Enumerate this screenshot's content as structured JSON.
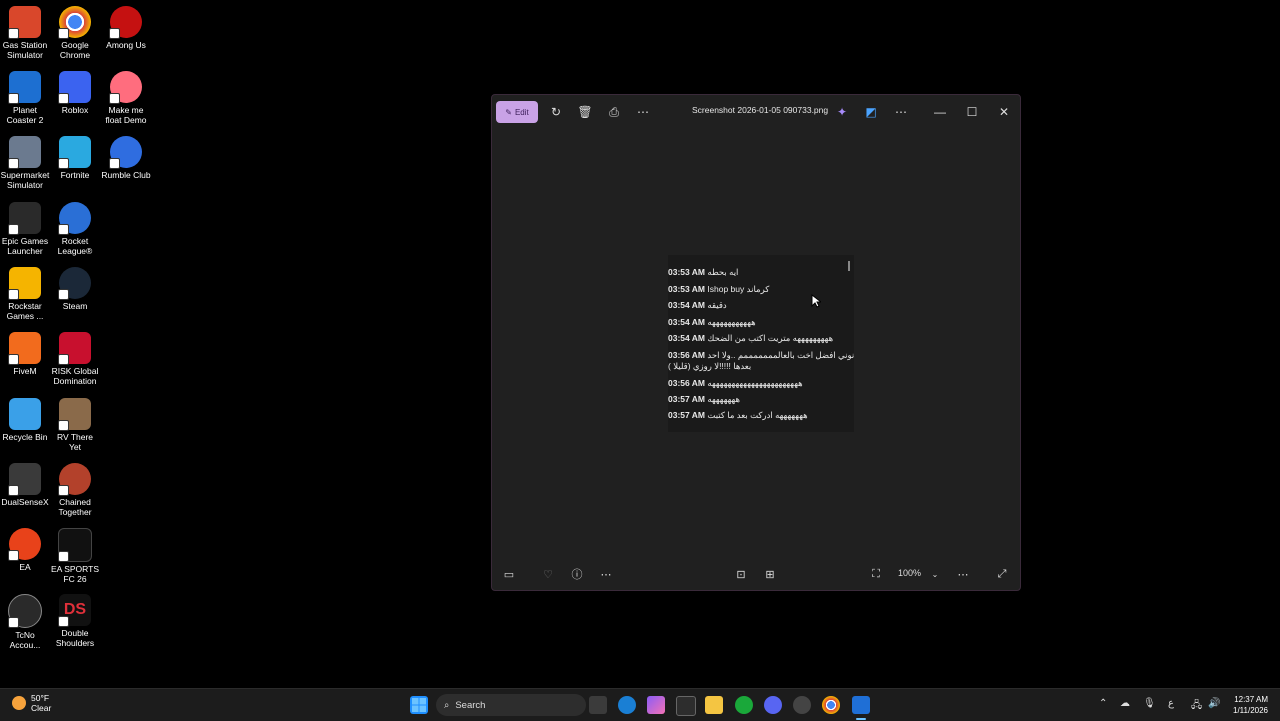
{
  "desktop": {
    "icons": [
      {
        "label": "Gas Station Simulator",
        "color": "#d9472b"
      },
      {
        "label": "Google Chrome",
        "color": "#4285f4"
      },
      {
        "label": "Among Us",
        "color": "#c51111"
      },
      {
        "label": "Planet Coaster 2",
        "color": "#1d6fd1"
      },
      {
        "label": "Roblox",
        "color": "#3b63f0"
      },
      {
        "label": "Make me float Demo",
        "color": "#ff6d7e"
      },
      {
        "label": "Supermarket Simulator",
        "color": "#6b7a8f"
      },
      {
        "label": "Fortnite",
        "color": "#2aa9e0"
      },
      {
        "label": "Rumble Club",
        "color": "#2f6de0"
      },
      {
        "label": "Epic Games Launcher",
        "color": "#2a2a2a"
      },
      {
        "label": "Rocket League®",
        "color": "#2a6fd6"
      },
      {
        "label": "Rockstar Games ...",
        "color": "#f5b400"
      },
      {
        "label": "Steam",
        "color": "#1b2838"
      },
      {
        "label": "FiveM",
        "color": "#f26b1d"
      },
      {
        "label": "RISK Global Domination",
        "color": "#c8102e"
      },
      {
        "label": "Recycle Bin",
        "color": "#3aa0e8"
      },
      {
        "label": "RV There Yet",
        "color": "#8a6a4a"
      },
      {
        "label": "DualSenseX",
        "color": "#3a3a3a"
      },
      {
        "label": "Chained Together",
        "color": "#b3412b"
      },
      {
        "label": "EA",
        "color": "#e8421a"
      },
      {
        "label": "EA SPORTS FC 26",
        "color": "#111111"
      },
      {
        "label": "TcNo Accou...",
        "color": "#2a2a2a"
      },
      {
        "label": "Double Shoulders",
        "color": "#111111"
      }
    ]
  },
  "window": {
    "edit_label": "Edit",
    "title": "Screenshot 2026-01-05 090733.png",
    "zoom": "100%",
    "messages": [
      {
        "time": "03:53 AM",
        "text": "ايه بحطه"
      },
      {
        "time": "03:53 AM",
        "text": "Ishop buy كرماند"
      },
      {
        "time": "03:54 AM",
        "text": "دقيقه"
      },
      {
        "time": "03:54 AM",
        "text": "هههههههههههه"
      },
      {
        "time": "03:54 AM",
        "text": "هههههههههه متريت اكتب من الضحك"
      },
      {
        "time": "03:56 AM",
        "text": "نوني افضل اخت بالعالمممممممم ..ولا احد"
      },
      {
        "time": "",
        "text": "بعدها !!!!!لا روزي (قليلا )"
      },
      {
        "time": "03:56 AM",
        "text": "هههههههههههههههههههههههه"
      },
      {
        "time": "03:57 AM",
        "text": "هههههههه"
      },
      {
        "time": "03:57 AM",
        "text": "هههههههه ادركت بعد ما كتبت"
      }
    ]
  },
  "taskbar": {
    "weather_temp": "50°F",
    "weather_desc": "Clear",
    "search_placeholder": "Search",
    "tray_lang": "ع",
    "time": "12:37 AM",
    "date": "1/11/2026"
  }
}
